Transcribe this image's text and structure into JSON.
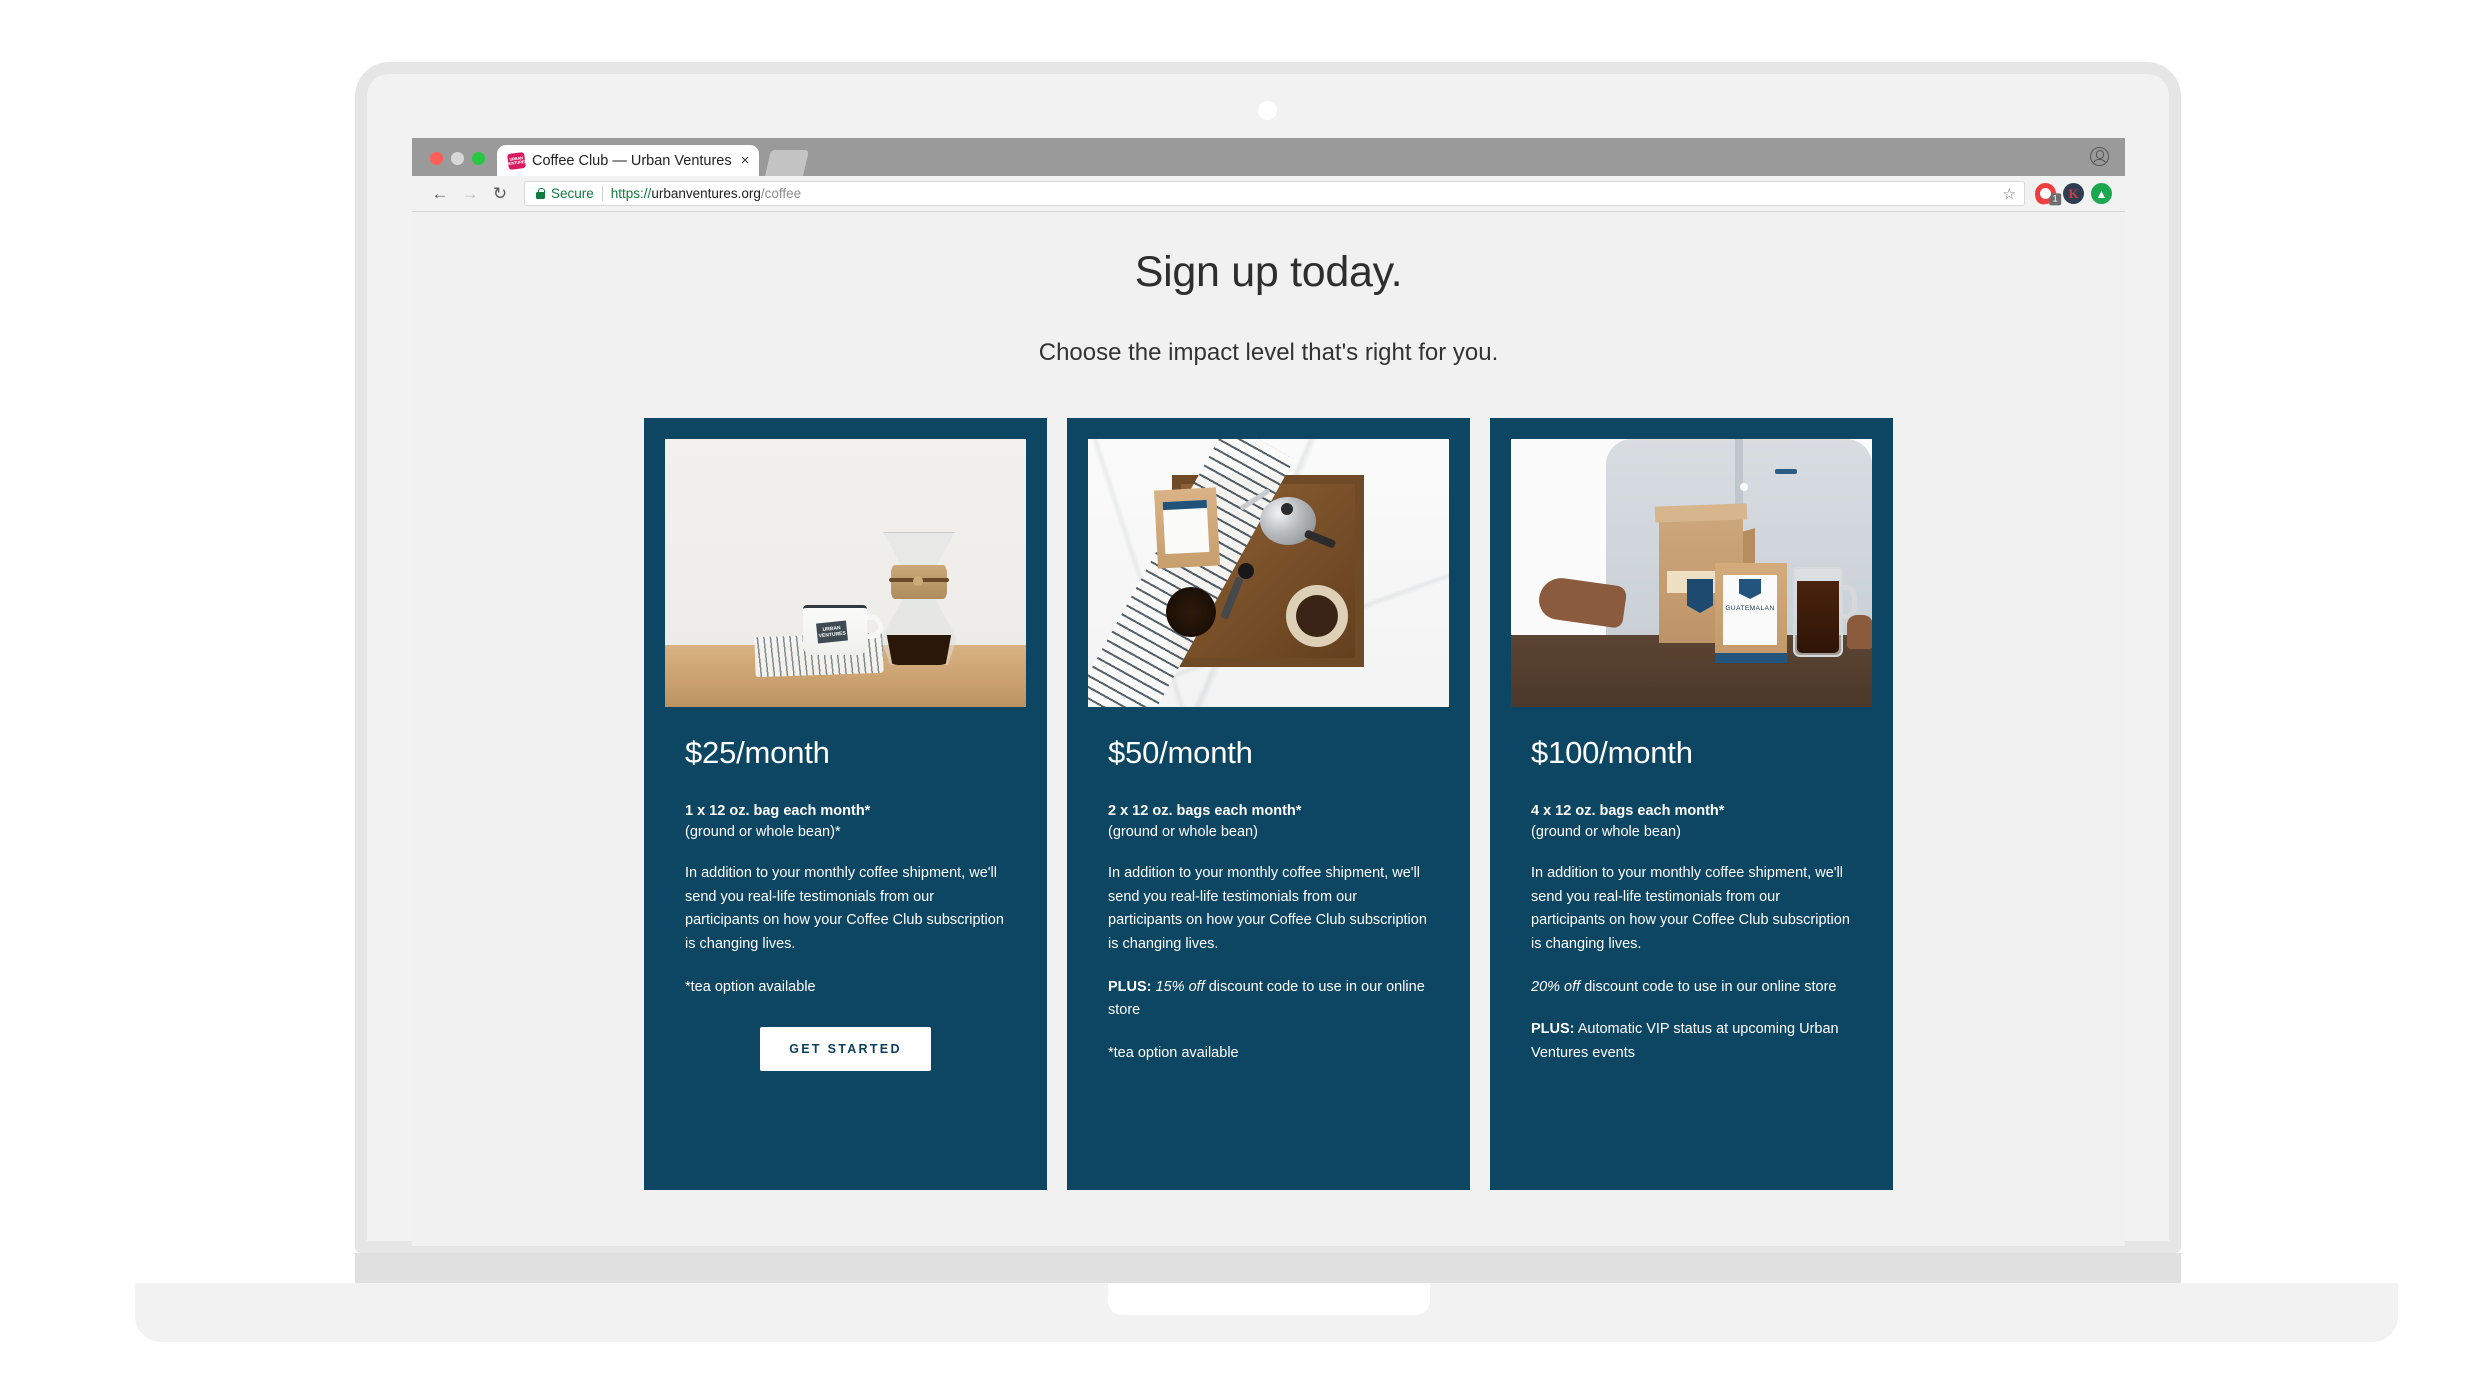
{
  "browser": {
    "tab": {
      "title": "Coffee Club — Urban Ventures",
      "favicon_text": "URBAN VENTURES",
      "close_label": "×"
    },
    "toolbar": {
      "back_label": "←",
      "forward_label": "→",
      "reload_label": "↻",
      "security_label": "Secure",
      "url_scheme": "https://",
      "url_host": "urbanventures.org",
      "url_path": "/coffee",
      "bookmark_label": "☆",
      "extensions": [
        {
          "name": "pocket-extension-icon",
          "badge": "1"
        },
        {
          "name": "k-extension-icon",
          "label": "K"
        },
        {
          "name": "upload-extension-icon",
          "label": "▲"
        }
      ]
    },
    "profile_label": ""
  },
  "page": {
    "title": "Sign up today.",
    "subtitle": "Choose the impact level that's right for you.",
    "cards": [
      {
        "price": "$25/month",
        "spec": "1 x 12 oz. bag each month*",
        "subspec": "(ground or whole bean)*",
        "description": "In addition to your monthly coffee shipment, we'll send you real-life testimonials from our participants on how your Coffee Club subscription is changing lives.",
        "perk_prefix": "",
        "perk_emphasis": "",
        "perk_rest": "",
        "footnote": "*tea option available",
        "bonus_prefix": "",
        "bonus_rest": "",
        "cta": "GET STARTED",
        "photo_alt": "chemex-and-mug-photo"
      },
      {
        "price": "$50/month",
        "spec": "2 x 12 oz. bags each month*",
        "subspec": "(ground or whole bean)",
        "description": "In addition to your monthly coffee shipment, we'll send you real-life testimonials from our participants on how your Coffee Club subscription is changing lives.",
        "perk_prefix": "PLUS:",
        "perk_emphasis": " 15% off",
        "perk_rest": " discount code to use in our online store",
        "footnote": "*tea option available",
        "bonus_prefix": "",
        "bonus_rest": "",
        "cta": "",
        "photo_alt": "marble-flatlay-coffee-tray-photo"
      },
      {
        "price": "$100/month",
        "spec": "4 x 12 oz. bags each month*",
        "subspec": "(ground or whole bean)",
        "description": "In addition to your monthly coffee shipment, we'll send you real-life testimonials from our participants on how your Coffee Club subscription is changing lives.",
        "perk_prefix": "",
        "perk_emphasis": "20% off",
        "perk_rest": " discount code to use in our online store",
        "footnote": "",
        "bonus_prefix": "PLUS:",
        "bonus_rest": " Automatic VIP status at upcoming Urban Ventures events",
        "cta": "",
        "photo_alt": "person-with-gift-box-photo"
      }
    ],
    "photo_labels": {
      "mug_brand": "URBAN VENTURES",
      "bag_origin": "GUATEMALAN"
    }
  },
  "colors": {
    "card_navy": "#0d4663",
    "page_background": "#f1f1f1",
    "secure_green": "#117a3d",
    "cta_text": "#0d3f5c"
  }
}
